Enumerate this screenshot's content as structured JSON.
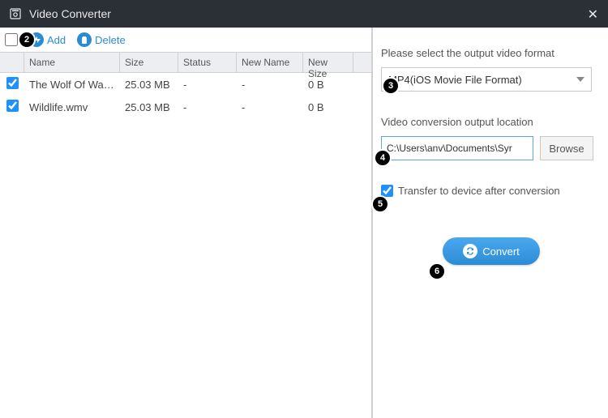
{
  "window": {
    "title": "Video Converter"
  },
  "toolbar": {
    "add_label": "Add",
    "delete_label": "Delete"
  },
  "table": {
    "headers": {
      "name": "Name",
      "size": "Size",
      "status": "Status",
      "newname": "New Name",
      "newsize": "New Size"
    },
    "rows": [
      {
        "checked": true,
        "name": "The Wolf Of Wall S...",
        "size": "25.03 MB",
        "status": "-",
        "newname": "-",
        "newsize": "0 B"
      },
      {
        "checked": true,
        "name": "Wildlife.wmv",
        "size": "25.03 MB",
        "status": "-",
        "newname": "-",
        "newsize": "0 B"
      }
    ]
  },
  "right": {
    "format_label": "Please select the output video format",
    "format_value": "MP4(iOS Movie File Format)",
    "output_label": "Video conversion output location",
    "output_path": "C:\\Users\\anv\\Documents\\Syr",
    "browse_label": "Browse",
    "transfer_label": "Transfer to device after conversion",
    "convert_label": "Convert"
  },
  "markers": {
    "m2": "2",
    "m3": "3",
    "m4": "4",
    "m5": "5",
    "m6": "6"
  }
}
